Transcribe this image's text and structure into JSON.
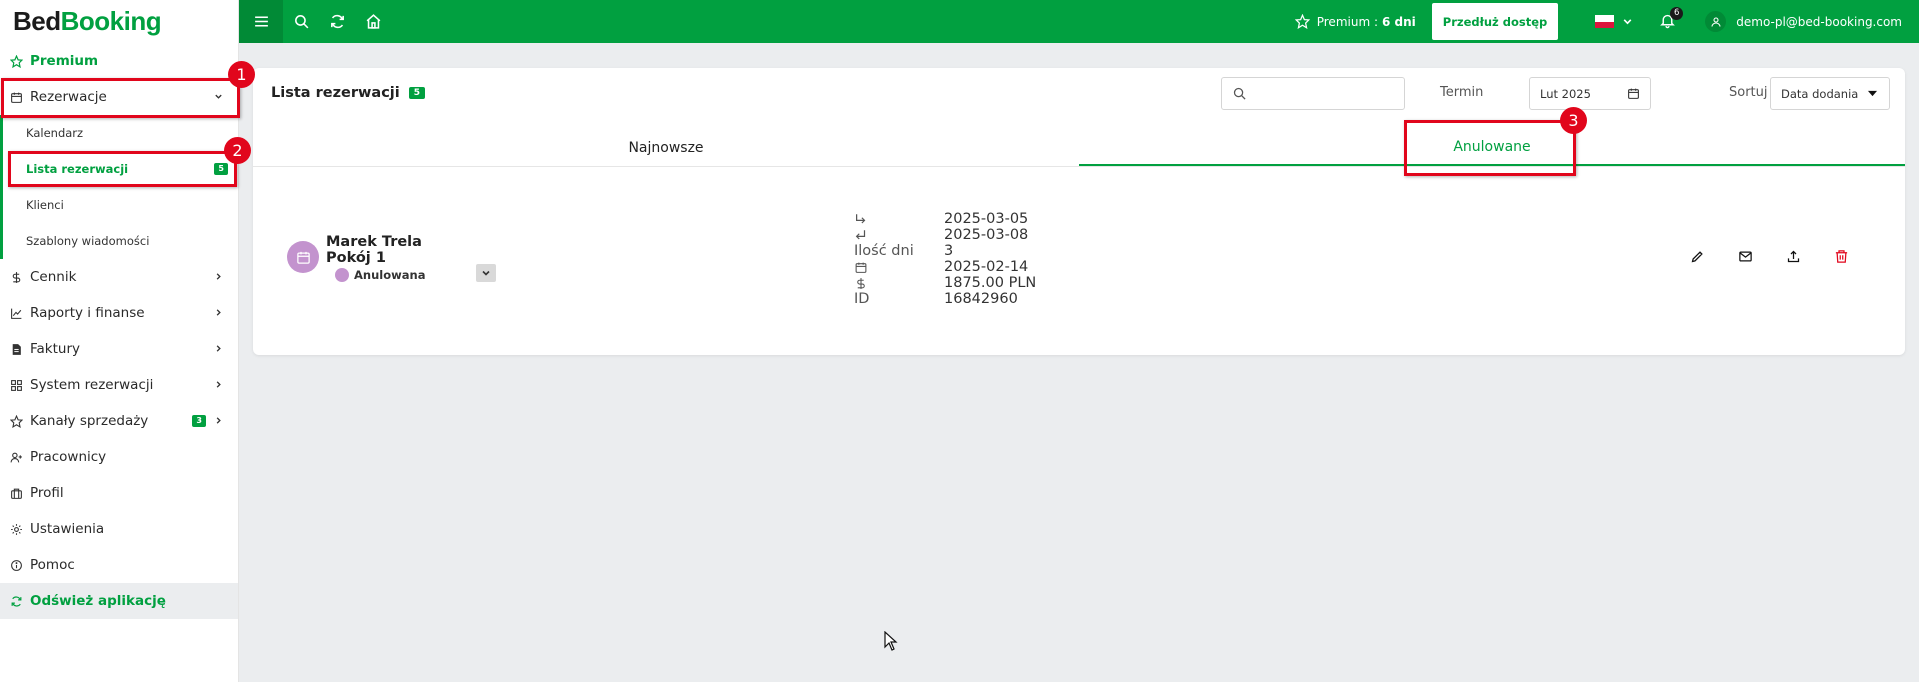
{
  "logo": {
    "part1": "Bed",
    "part2": "Booking"
  },
  "sidebar": {
    "premium": "Premium",
    "reservations": "Rezerwacje",
    "sub_items": [
      {
        "label": "Kalendarz"
      },
      {
        "label": "Lista rezerwacji",
        "badge": "5"
      },
      {
        "label": "Klienci"
      },
      {
        "label": "Szablony wiadomości"
      }
    ],
    "items": [
      {
        "label": "Cennik"
      },
      {
        "label": "Raporty i finanse"
      },
      {
        "label": "Faktury"
      },
      {
        "label": "System rezerwacji"
      },
      {
        "label": "Kanały sprzedaży",
        "badge": "3"
      },
      {
        "label": "Pracownicy"
      },
      {
        "label": "Profil"
      },
      {
        "label": "Ustawienia"
      },
      {
        "label": "Pomoc"
      }
    ],
    "refresh": "Odśwież aplikację"
  },
  "topbar": {
    "premium_label": "Premium :",
    "premium_days": "6 dni",
    "extend_button": "Przedłuż dostęp",
    "notifications_count": "6",
    "user_email": "demo-pl@bed-booking.com"
  },
  "main": {
    "title": "Lista rezerwacji",
    "title_badge": "5",
    "search_placeholder": "",
    "term_label": "Termin",
    "term_value": "Lut 2025",
    "sort_label": "Sortuj",
    "sort_value": "Data dodania",
    "tabs": [
      {
        "label": "Najnowsze",
        "active": false
      },
      {
        "label": "Anulowane",
        "active": true
      }
    ]
  },
  "reservation": {
    "name_line1": "Marek Trela",
    "name_line2": "Pokój 1",
    "status": "Anulowana",
    "checkin": "2025-03-05",
    "checkout": "2025-03-08",
    "days_label": "Ilość dni",
    "days": "3",
    "created": "2025-02-14",
    "price": "1875.00 PLN",
    "id_label": "ID",
    "id": "16842960"
  },
  "annotations": [
    "1",
    "2",
    "3"
  ],
  "colors": {
    "brand": "#01a040",
    "highlight": "#e1061c",
    "status_cancelled": "#c393ce"
  }
}
